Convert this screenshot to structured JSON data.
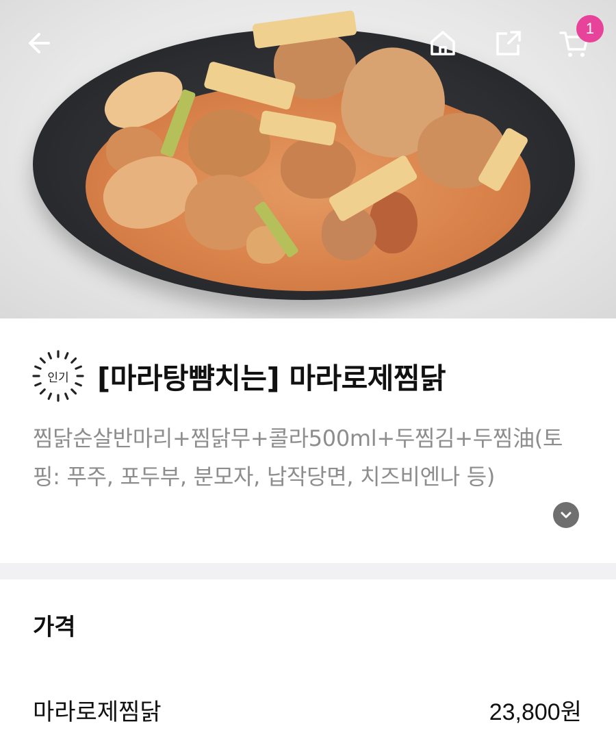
{
  "header": {
    "back_icon": "arrow-left-icon",
    "home_icon": "home-icon",
    "share_icon": "share-icon",
    "cart_icon": "cart-icon",
    "cart_count": "1",
    "badge_color": "#e8439a"
  },
  "product": {
    "badge_text": "인기",
    "title": "[마라탕뺨치는] 마라로제찜닭",
    "description": "찜닭순살반마리+찜닭무+콜라500ml+두찜김+두찜油(토핑: 푸주, 포두부, 분모자, 납작당면, 치즈비엔나 등)",
    "expand_icon": "chevron-down-icon"
  },
  "price_section": {
    "title": "가격",
    "items": [
      {
        "name": "마라로제찜닭",
        "price": "23,800원"
      }
    ]
  }
}
